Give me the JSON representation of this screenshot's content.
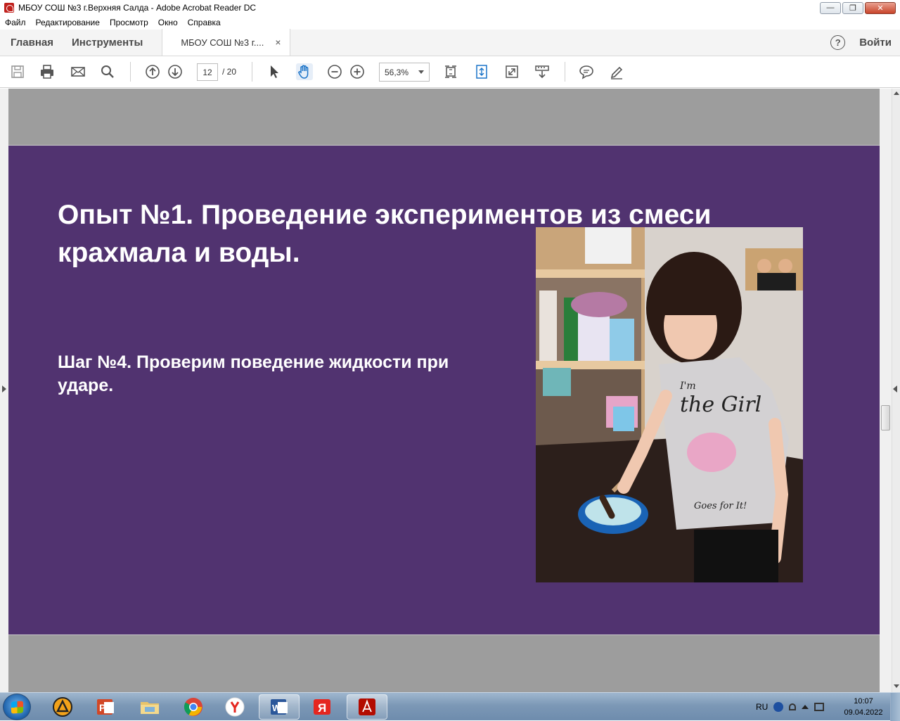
{
  "window": {
    "title": "МБОУ СОШ №3 г.Верхняя Салда - Adobe Acrobat Reader DC",
    "controls": [
      "minimize",
      "restore",
      "close"
    ]
  },
  "menu": [
    "Файл",
    "Редактирование",
    "Просмотр",
    "Окно",
    "Справка"
  ],
  "tabs": {
    "home": "Главная",
    "tools": "Инструменты",
    "document": "МБОУ СОШ №3 г....",
    "close_glyph": "×",
    "help_glyph": "?",
    "signin": "Войти"
  },
  "toolbar": {
    "icons": [
      "save-icon",
      "print-icon",
      "email-icon",
      "search-icon",
      "page-up-icon",
      "page-down-icon",
      "select-icon",
      "hand-icon",
      "zoom-out-icon",
      "zoom-in-icon",
      "fit-page-icon",
      "scrolling-mode-icon",
      "full-screen-icon",
      "read-mode-icon",
      "comment-icon",
      "sign-icon"
    ],
    "page_current": "12",
    "page_total": "/ 20",
    "zoom": "56,3%"
  },
  "slide": {
    "title": "Опыт №1. Проведение экспериментов из смеси крахмала и воды.",
    "step": "Шаг №4. Проверим поведение жидкости при ударе.",
    "background": "#513370"
  },
  "photo": {
    "shirt_text_line1": "I'm",
    "shirt_text_line2": "the Girl",
    "shirt_text_line3": "Goes for It!"
  },
  "taskbar": {
    "apps": [
      "aimp-icon",
      "powerpoint-icon",
      "explorer-icon",
      "chrome-icon",
      "yandex-browser-icon",
      "word-icon",
      "yandex-icon",
      "acrobat-icon"
    ],
    "language": "RU",
    "time": "10:07",
    "date": "09.04.2022"
  }
}
